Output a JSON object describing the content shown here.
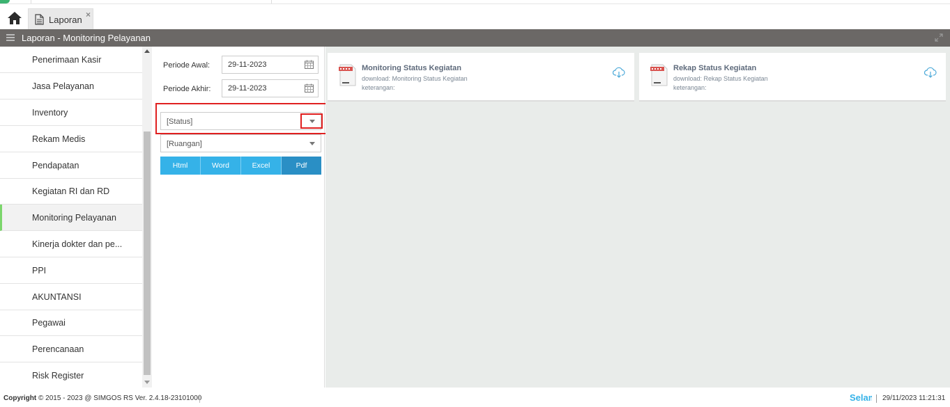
{
  "tab": {
    "label": "Laporan",
    "close": "×"
  },
  "titlebar": {
    "title": "Laporan - Monitoring Pelayanan"
  },
  "sidebar": {
    "items": [
      {
        "label": "Penerimaan Kasir"
      },
      {
        "label": "Jasa Pelayanan"
      },
      {
        "label": "Inventory"
      },
      {
        "label": "Rekam Medis"
      },
      {
        "label": "Pendapatan"
      },
      {
        "label": "Kegiatan RI dan RD"
      },
      {
        "label": "Monitoring Pelayanan"
      },
      {
        "label": "Kinerja dokter dan pe..."
      },
      {
        "label": "PPI"
      },
      {
        "label": "AKUNTANSI"
      },
      {
        "label": "Pegawai"
      },
      {
        "label": "Perencanaan"
      },
      {
        "label": "Risk Register"
      }
    ],
    "active_index": 6
  },
  "filter": {
    "periode_awal_label": "Periode Awal:",
    "periode_awal_value": "29-11-2023",
    "periode_akhir_label": "Periode Akhir:",
    "periode_akhir_value": "29-11-2023",
    "status_placeholder": "[Status]",
    "ruangan_placeholder": "[Ruangan]",
    "buttons": {
      "html": "Html",
      "word": "Word",
      "excel": "Excel",
      "pdf": "Pdf"
    }
  },
  "cards": [
    {
      "title": "Monitoring Status Kegiatan",
      "download": "download: Monitoring Status Kegiatan",
      "keterangan": "keterangan:"
    },
    {
      "title": "Rekap Status Kegiatan",
      "download": "download: Rekap Status Kegiatan",
      "keterangan": "keterangan:"
    }
  ],
  "footer": {
    "copyright_bold": "Copyright",
    "copyright_rest": " 2015 - 2023 @ SIMGOS RS Ver. 2.4.18-23101000",
    "marquee": "Selamat",
    "datetime": "29/11/2023 11:21:31"
  },
  "colors": {
    "accent": "#35b2e8",
    "accent_active": "#2a8fc5",
    "titlebar": "#6b6866",
    "highlight": "#e02020",
    "active_marker": "#7cd66c"
  }
}
